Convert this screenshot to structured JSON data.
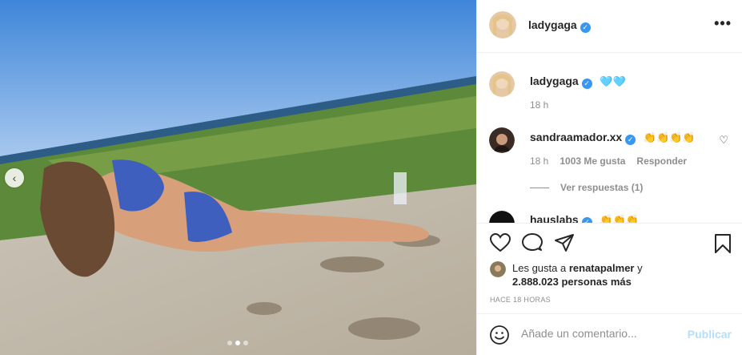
{
  "post": {
    "username": "ladygaga",
    "more_icon": "more-horizontal-icon",
    "prev_icon": "chevron-left-icon",
    "carousel_dots": 3,
    "carousel_active": 1
  },
  "caption": {
    "username": "ladygaga",
    "text": "🩵🩵",
    "time": "18 h"
  },
  "comments": [
    {
      "username": "sandraamador.xx",
      "text": "👏👏👏👏",
      "time": "18 h",
      "likes": "1003 Me gusta",
      "reply": "Responder",
      "view_replies": "Ver respuestas (1)"
    },
    {
      "username": "hauslabs",
      "text": "👏👏👏"
    }
  ],
  "likes": {
    "prefix": "Les gusta a",
    "user": "renatapalmer",
    "conj": "y",
    "count": "2.888.023 personas más"
  },
  "timestamp": "HACE 18 HORAS",
  "composer": {
    "placeholder": "Añade un comentario...",
    "publish_label": "Publicar"
  },
  "colors": {
    "verified": "#3897f0",
    "publish_disabled": "#b2dffc",
    "muted": "#8e8e8e"
  }
}
